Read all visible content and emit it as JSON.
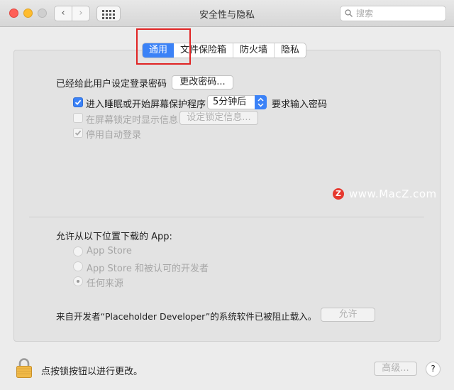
{
  "window": {
    "title": "安全性与隐私",
    "search_placeholder": "搜索"
  },
  "toolbar": {
    "back": "‹",
    "forward": "›"
  },
  "tabs": [
    {
      "label": "通用",
      "active": true
    },
    {
      "label": "文件保险箱",
      "active": false
    },
    {
      "label": "防火墙",
      "active": false
    },
    {
      "label": "隐私",
      "active": false
    }
  ],
  "general": {
    "password_set_text": "已经给此用户设定登录密码",
    "change_password_button": "更改密码...",
    "require_password": {
      "label_before": "进入睡眠或开始屏幕保护程序",
      "select_value": "5分钟后",
      "label_after": "要求输入密码",
      "checked": true
    },
    "show_message": {
      "label": "在屏幕锁定时显示信息",
      "button": "设定锁定信息...",
      "checked": false
    },
    "disable_auto_login": {
      "label": "停用自动登录",
      "checked": true
    }
  },
  "downloads": {
    "heading": "允许从以下位置下载的 App:",
    "options": [
      {
        "label": "App Store",
        "selected": false
      },
      {
        "label": "App Store 和被认可的开发者",
        "selected": false
      },
      {
        "label": "任何来源",
        "selected": true
      }
    ],
    "blocked_message": "来自开发者“Placeholder Developer”的系统软件已被阻止载入。",
    "allow_button": "允许"
  },
  "watermark": {
    "logo": "Z",
    "text": "www.MacZ.com"
  },
  "footer": {
    "lock_text": "点按锁按钮以进行更改。",
    "advanced_button": "高级...",
    "help_button": "?"
  },
  "colors": {
    "accent": "#3b82f7",
    "highlight_box": "#e02424",
    "lock": "#f0b948"
  }
}
